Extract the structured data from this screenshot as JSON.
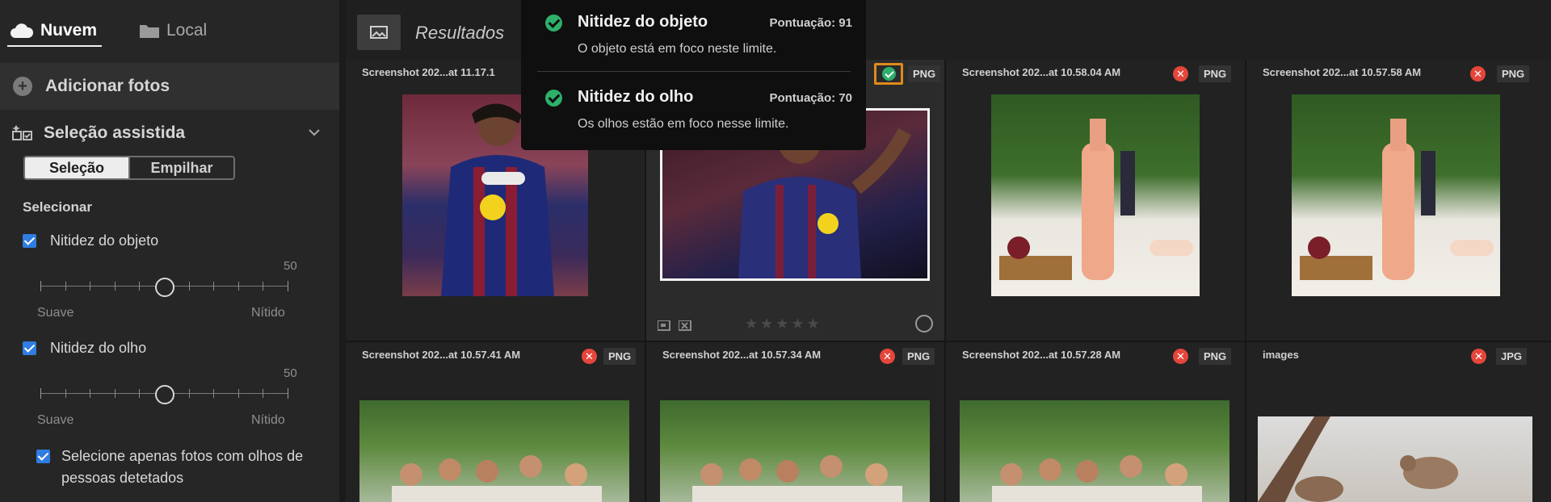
{
  "sidebar": {
    "tabs": [
      {
        "label": "Nuvem",
        "icon": "cloud-icon",
        "active": true
      },
      {
        "label": "Local",
        "icon": "folder-icon",
        "active": false
      }
    ],
    "add_photos": {
      "icon": "plus-circle-icon",
      "label": "Adicionar fotos"
    },
    "assisted": {
      "icon": "assisted-selection-icon",
      "label": "Seleção assistida",
      "segments": {
        "select": "Seleção",
        "stack": "Empilhar"
      },
      "section_label": "Selecionar",
      "sliders": [
        {
          "label": "Nitidez do objeto",
          "checked": true,
          "value": "50",
          "value_fraction": 0.5,
          "min_label": "Suave",
          "max_label": "Nítido"
        },
        {
          "label": "Nitidez do olho",
          "checked": true,
          "value": "50",
          "value_fraction": 0.5,
          "min_label": "Suave",
          "max_label": "Nítido"
        }
      ],
      "eyes_only": {
        "checked": true,
        "label": "Selecione apenas fotos com olhos de pessoas detetados"
      }
    }
  },
  "main": {
    "title": "Resultados",
    "grid": [
      {
        "name": "Screenshot 202...at 11.17.1",
        "status": "rejected",
        "format": ""
      },
      {
        "name": "",
        "status": "accepted",
        "format": "PNG",
        "selected": true,
        "rating": "★★★★★"
      },
      {
        "name": "Screenshot 202...at 10.58.04 AM",
        "status": "rejected",
        "format": "PNG"
      },
      {
        "name": "Screenshot 202...at 10.57.58 AM",
        "status": "rejected",
        "format": "PNG"
      },
      {
        "name": "Screenshot 202...at 10.57.41 AM",
        "status": "rejected",
        "format": "PNG"
      },
      {
        "name": "Screenshot 202...at 10.57.34 AM",
        "status": "rejected",
        "format": "PNG"
      },
      {
        "name": "Screenshot 202...at 10.57.28 AM",
        "status": "rejected",
        "format": "PNG"
      },
      {
        "name": "images",
        "status": "rejected",
        "format": "JPG"
      }
    ]
  },
  "tooltip": {
    "items": [
      {
        "title": "Nitidez do objeto",
        "score": "Pontuação: 91",
        "desc": "O objeto está em foco neste limite."
      },
      {
        "title": "Nitidez do olho",
        "score": "Pontuação: 70",
        "desc": "Os olhos estão em foco nesse limite."
      }
    ]
  },
  "colors": {
    "accent_blue": "#2f7de1",
    "accepted_green": "#2eaf6a",
    "rejected_red": "#e5463b",
    "highlight_orange": "#e08a1c"
  }
}
